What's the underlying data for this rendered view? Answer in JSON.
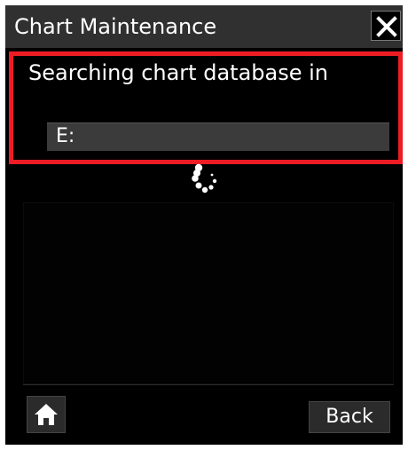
{
  "window": {
    "title": "Chart Maintenance",
    "close_icon": "close-icon"
  },
  "message": {
    "text": "Searching chart database in",
    "path": "E:",
    "highlight_color": "#ee1c25"
  },
  "status": {
    "spinner_icon": "loading-spinner-icon"
  },
  "footer": {
    "home_icon": "home-icon",
    "back_label": "Back"
  },
  "colors": {
    "background": "#000000",
    "title_bar": "#303030",
    "field": "#3b3b3b",
    "button": "#2b2b2b",
    "text": "#ffffff"
  }
}
